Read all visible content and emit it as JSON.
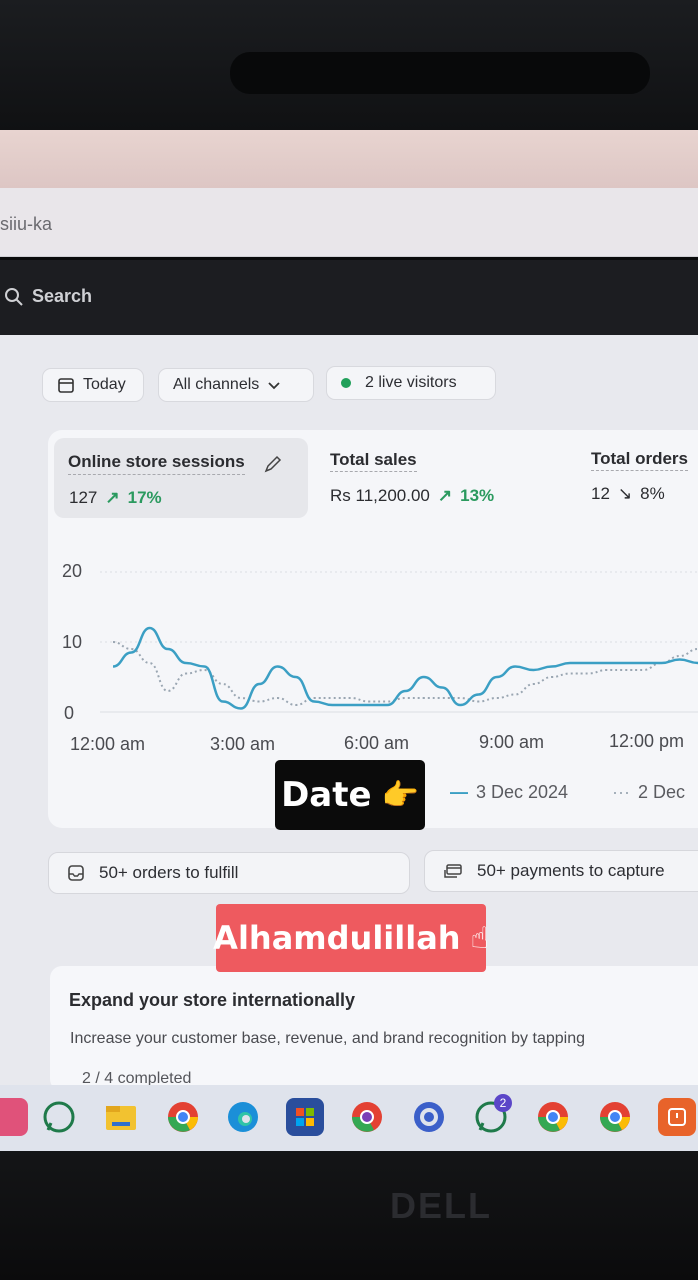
{
  "browser": {
    "url_fragment": "siiu-ka"
  },
  "admin_bar": {
    "search_label": "Search"
  },
  "filters": {
    "date": "Today",
    "channels": "All channels",
    "live_visitors": "2 live visitors"
  },
  "metrics": [
    {
      "label": "Online store sessions",
      "value": "127",
      "change": "17%",
      "direction": "up"
    },
    {
      "label": "Total sales",
      "value": "Rs 11,200.00",
      "change": "13%",
      "direction": "up"
    },
    {
      "label": "Total orders",
      "value": "12",
      "change": "8%",
      "direction": "down"
    }
  ],
  "chart_data": {
    "type": "line",
    "x": [
      "12:00 am",
      "3:00 am",
      "6:00 am",
      "9:00 am",
      "12:00 pm"
    ],
    "y_ticks": [
      "0",
      "10",
      "20"
    ],
    "ylim": [
      0,
      20
    ],
    "series": [
      {
        "name": "3 Dec 2024",
        "style": "solid",
        "color": "#3b9fc4",
        "points": [
          [
            0,
            6.5
          ],
          [
            1,
            8.5
          ],
          [
            2,
            12
          ],
          [
            3,
            9
          ],
          [
            4,
            7
          ],
          [
            5,
            6.5
          ],
          [
            6,
            1.5
          ],
          [
            7,
            0.5
          ],
          [
            8,
            4
          ],
          [
            9,
            6.5
          ],
          [
            10,
            5
          ],
          [
            11,
            1.5
          ],
          [
            12,
            1
          ],
          [
            13,
            1
          ],
          [
            14,
            1
          ],
          [
            15,
            1
          ],
          [
            16,
            3
          ],
          [
            17,
            5
          ],
          [
            18,
            3.5
          ],
          [
            19,
            1
          ],
          [
            20,
            2.5
          ],
          [
            21,
            5
          ],
          [
            22,
            6.5
          ],
          [
            23,
            6
          ],
          [
            24,
            6.5
          ],
          [
            25,
            7
          ],
          [
            26,
            7
          ],
          [
            27,
            7
          ],
          [
            28,
            7
          ],
          [
            29,
            7
          ],
          [
            30,
            7
          ],
          [
            31,
            7.5
          ],
          [
            32,
            7
          ]
        ]
      },
      {
        "name": "2 Dec",
        "style": "dotted",
        "color": "#9aa6b2",
        "points": [
          [
            0,
            10
          ],
          [
            1,
            9
          ],
          [
            2,
            7
          ],
          [
            3,
            3
          ],
          [
            4,
            5.5
          ],
          [
            5,
            6
          ],
          [
            6,
            4
          ],
          [
            7,
            2
          ],
          [
            8,
            1.5
          ],
          [
            9,
            2
          ],
          [
            10,
            1
          ],
          [
            11,
            2
          ],
          [
            12,
            2
          ],
          [
            13,
            2
          ],
          [
            14,
            1.5
          ],
          [
            15,
            1.5
          ],
          [
            16,
            2
          ],
          [
            17,
            2
          ],
          [
            18,
            2
          ],
          [
            19,
            2
          ],
          [
            20,
            1.5
          ],
          [
            21,
            2
          ],
          [
            22,
            2.5
          ],
          [
            23,
            4
          ],
          [
            24,
            5
          ],
          [
            25,
            5.5
          ],
          [
            26,
            5.5
          ],
          [
            27,
            6
          ],
          [
            28,
            6
          ],
          [
            29,
            6
          ],
          [
            30,
            7
          ],
          [
            31,
            8
          ],
          [
            32,
            9
          ]
        ]
      }
    ]
  },
  "legend": {
    "current": "3 Dec 2024",
    "previous": "2 Dec"
  },
  "actions": {
    "orders": "50+ orders to fulfill",
    "payments": "50+ payments to capture"
  },
  "overlays": {
    "date_sticker": "Date",
    "alhamdulillah_sticker": "Alhamdulillah"
  },
  "expand": {
    "title": "Expand your store internationally",
    "description": "Increase your customer base, revenue, and brand recognition by tapping",
    "progress": "2 / 4 completed"
  },
  "taskbar": {
    "icons": [
      "whatsapp-icon",
      "file-explorer-icon",
      "chrome-icon",
      "edge-icon",
      "store-icon",
      "chrome-profile-icon",
      "chrome-app-icon",
      "whatsapp-badge-icon",
      "chrome-icon-2",
      "chrome-icon-3",
      "app-icon"
    ],
    "whatsapp_badge": "2"
  },
  "brand": {
    "logo": "DELL"
  }
}
